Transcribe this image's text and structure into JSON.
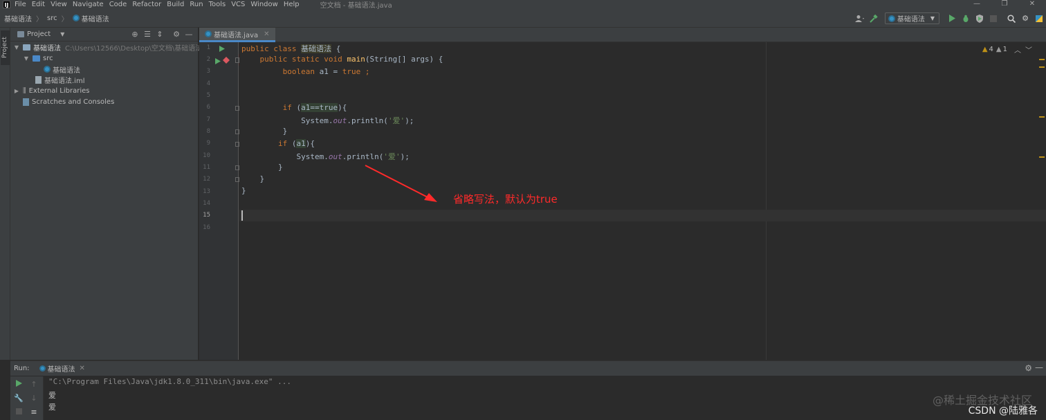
{
  "menu": {
    "logo": "IJ",
    "items": [
      "File",
      "Edit",
      "View",
      "Navigate",
      "Code",
      "Refactor",
      "Build",
      "Run",
      "Tools",
      "VCS",
      "Window",
      "Help"
    ],
    "window_title": "空文档 - 基础语法.java",
    "controls": [
      "—",
      "❐",
      "✕"
    ]
  },
  "navbar": {
    "breadcrumbs": [
      "基础语法",
      "src",
      "基础语法"
    ],
    "run_config": "基础语法"
  },
  "left_stripe": {
    "project_label": "Project"
  },
  "project_panel": {
    "title": "Project",
    "tree": {
      "root_name": "基础语法",
      "root_path": "C:\\Users\\12566\\Desktop\\空文档\\基础语法",
      "src": "src",
      "class_file": "基础语法",
      "iml_file": "基础语法.iml",
      "external_libraries": "External Libraries",
      "scratches": "Scratches and Consoles"
    }
  },
  "editor": {
    "tab_label": "基础语法.java",
    "line_numbers": [
      "1",
      "2",
      "3",
      "4",
      "5",
      "6",
      "7",
      "8",
      "9",
      "10",
      "11",
      "12",
      "13",
      "14",
      "15",
      "16"
    ],
    "inspections": {
      "warnings": "4",
      "weak_warnings": "1"
    },
    "code": {
      "l1_kw": "public class",
      "l1_name": "基础语法",
      "l1_rest": " {",
      "l2_kw": "public static void",
      "l2_fn": "main",
      "l2_rest": "(String[] args) {",
      "l3_kw": "boolean",
      "l3_rest": " a1 = ",
      "l3_val": "true",
      "l3_end": " ;",
      "l6_kw": "if",
      "l6_open": " (",
      "l6_cond": "a1==",
      "l6_true": "true",
      "l6_close": "){",
      "l7_a": "System.",
      "l7_out": "out",
      "l7_b": ".println(",
      "l7_str": "'爱'",
      "l7_c": ");",
      "l8": "}",
      "l9_kw": "if",
      "l9_open": " (",
      "l9_cond": "a1",
      "l9_close": "){",
      "l10_a": "System.",
      "l10_out": "out",
      "l10_b": ".println(",
      "l10_str": "'爱'",
      "l10_c": ");",
      "l11": "}",
      "l12": "}",
      "l13": "}"
    }
  },
  "annotation": {
    "text": "省略写法，默认为true",
    "color": "#ff2a2a"
  },
  "run_panel": {
    "label": "Run:",
    "tab": "基础语法",
    "console": [
      "\"C:\\Program Files\\Java\\jdk1.8.0_311\\bin\\java.exe\" ...",
      "爱",
      "爱"
    ]
  },
  "watermark": "@稀土掘金技术社区",
  "credit": "CSDN @陆雅各",
  "colors": {
    "keyword": "#cc7832",
    "method": "#ffc66d",
    "string": "#6a8759",
    "field": "#9876aa",
    "warning": "#be9117"
  }
}
